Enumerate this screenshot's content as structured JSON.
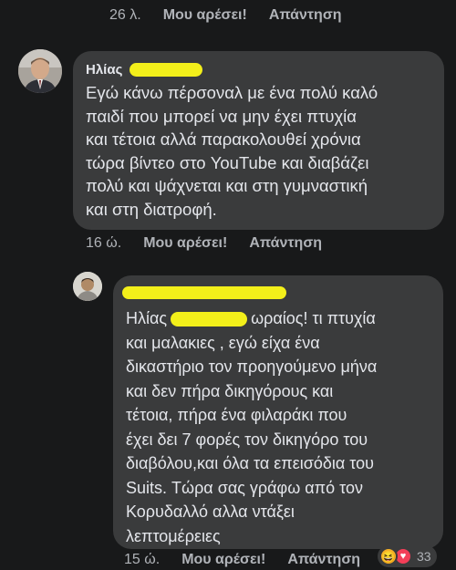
{
  "top_meta": {
    "time": "26 λ.",
    "like_label": "Μου αρέσει!",
    "reply_label": "Απάντηση"
  },
  "comment1": {
    "author": "Ηλίας",
    "avatar_icon": "profile-photo-man",
    "lines": [
      "Εγώ κάνω πέρσοναλ με ένα πολύ καλό",
      "παιδί που μπορεί να μην έχει πτυχία",
      "και τέτοια αλλά παρακολουθεί χρόνια",
      "τώρα βίντεο στο YouTube και διαβάζει",
      "πολύ και ψάχνεται και στη γυμναστική",
      "και στη διατροφή."
    ],
    "meta": {
      "time": "16 ώ.",
      "like_label": "Μου αρέσει!",
      "reply_label": "Απάντηση"
    }
  },
  "comment2": {
    "avatar_icon": "profile-photo-small",
    "mention": "Ηλίας",
    "first_line_rest": "ωραίος! τι πτυχία",
    "lines": [
      "και μαλακιες , εγώ  είχα ένα",
      "δικαστήριο τον προηγούμενο μήνα",
      "και δεν πήρα δικηγόρους και",
      "τέτοια, πήρα ένα φιλαράκι που",
      "έχει δει 7 φορές τον δικηγόρο του",
      "διαβόλου,και όλα τα επεισόδια του",
      "Suits. Τώρα σας γράφω από τον",
      "Κορυδαλλό αλλα ντάξει",
      "λεπτομέρειες"
    ],
    "meta": {
      "time": "15 ώ.",
      "like_label": "Μου αρέσει!",
      "reply_label": "Απάντηση"
    },
    "reactions": {
      "icons": [
        "laugh-reaction-icon",
        "love-reaction-icon"
      ],
      "count": "33"
    }
  },
  "colors": {
    "background": "#18191a",
    "bubble": "#3a3b3c",
    "text": "#e4e6eb",
    "meta": "#b0b3b8",
    "highlight": "#f3ef1a",
    "love": "#f33e58",
    "haha": "#f7b125"
  }
}
